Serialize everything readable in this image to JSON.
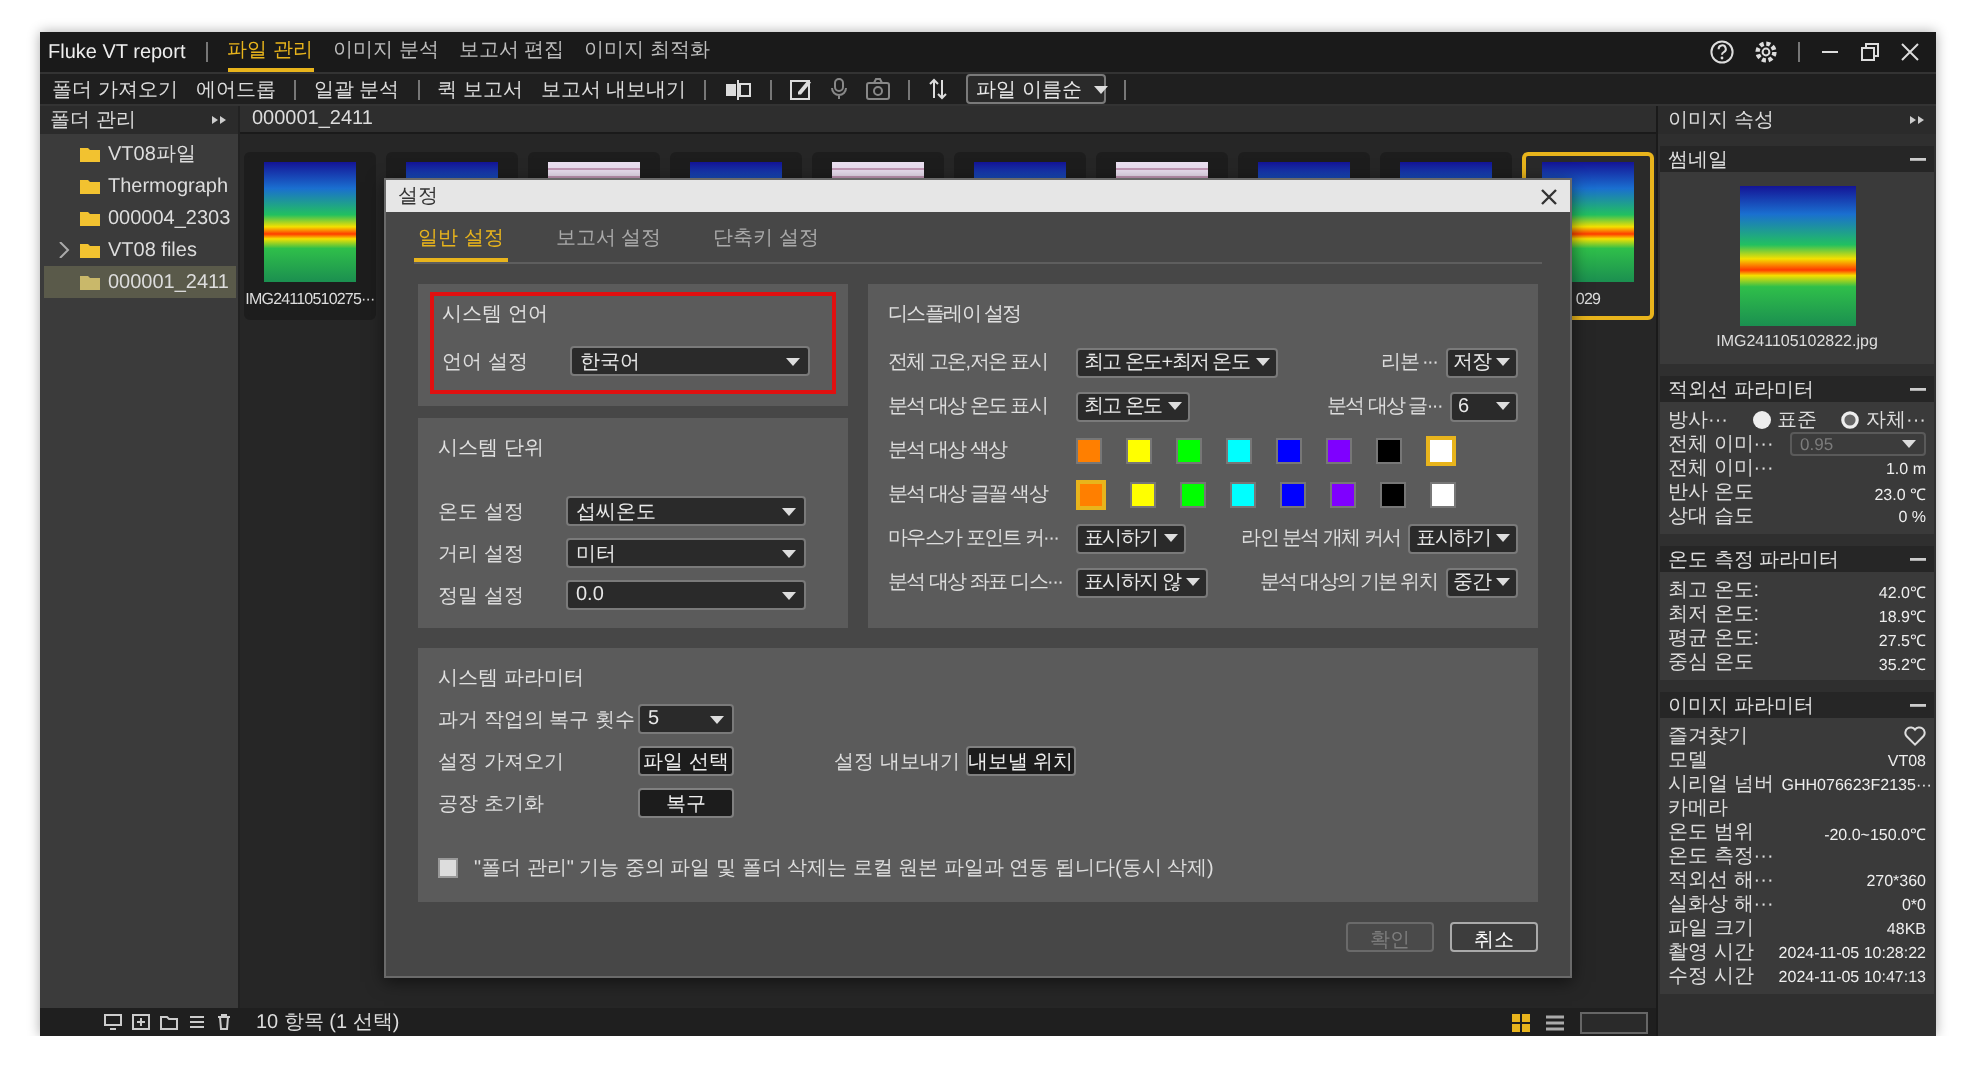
{
  "app": {
    "title": "Fluke VT report"
  },
  "menu_tabs": [
    {
      "label": "파일 관리",
      "selected": true
    },
    {
      "label": "이미지 분석",
      "selected": false
    },
    {
      "label": "보고서 편집",
      "selected": false
    },
    {
      "label": "이미지 최적화",
      "selected": false
    }
  ],
  "toolbar": {
    "groups": [
      [
        "폴더 가져오기",
        "에어드롭"
      ],
      [
        "일괄 분석"
      ],
      [
        "퀵 보고서",
        "보고서 내보내기"
      ]
    ],
    "sort": "파일 이름순"
  },
  "sidebar": {
    "title": "폴더 관리",
    "items": [
      {
        "label": "VT08파일",
        "expandable": false,
        "selected": false
      },
      {
        "label": "Thermograph",
        "expandable": false,
        "selected": false
      },
      {
        "label": "000004_2303",
        "expandable": false,
        "selected": false
      },
      {
        "label": "VT08 files",
        "expandable": true,
        "selected": false
      },
      {
        "label": "000001_2411",
        "expandable": false,
        "selected": true
      }
    ]
  },
  "content": {
    "path": "000001_2411",
    "thumbnails": [
      {
        "kind": "thermal",
        "label": "IMG24110510275···",
        "selected": false
      },
      {
        "kind": "thermal",
        "selected": false
      },
      {
        "kind": "document",
        "selected": false
      },
      {
        "kind": "thermal",
        "selected": false
      },
      {
        "kind": "document",
        "selected": false
      },
      {
        "kind": "thermal",
        "selected": false
      },
      {
        "kind": "document",
        "selected": false
      },
      {
        "kind": "thermal",
        "selected": false
      },
      {
        "kind": "thermal",
        "selected": false
      },
      {
        "kind": "thermal",
        "label": "029",
        "selected": true
      }
    ]
  },
  "settings": {
    "title": "설정",
    "tabs": [
      {
        "label": "일반 설정",
        "selected": true
      },
      {
        "label": "보고서 설정",
        "selected": false
      },
      {
        "label": "단축키 설정",
        "selected": false
      }
    ],
    "language": {
      "title": "시스템 언어",
      "highlighted": true,
      "rows": [
        {
          "label": "언어 설정",
          "value": "한국어"
        }
      ]
    },
    "units": {
      "title": "시스템 단위",
      "rows": [
        {
          "label": "온도 설정",
          "value": "섭씨온도"
        },
        {
          "label": "거리 설정",
          "value": "미터"
        },
        {
          "label": "정밀 설정",
          "value": "0.0"
        }
      ]
    },
    "display": {
      "title": "디스플레이 설정",
      "rows": [
        {
          "kind": "selects",
          "fields": [
            {
              "label": "전체 고온,저온 표시",
              "value": "최고 온도+최저 온도"
            },
            {
              "label": "리본 ···",
              "value": "저장"
            }
          ]
        },
        {
          "kind": "selects",
          "fields": [
            {
              "label": "분석 대상 온도 표시",
              "value": "최고 온도"
            },
            {
              "label": "분석 대상 글···",
              "value": "6"
            }
          ]
        },
        {
          "kind": "swatches",
          "label": "분석 대상 색상",
          "swatches": [
            {
              "color": "#ff7f00",
              "selected": false
            },
            {
              "color": "#ffff00",
              "selected": false
            },
            {
              "color": "#00ff00",
              "selected": false
            },
            {
              "color": "#00ffff",
              "selected": false
            },
            {
              "color": "#0000ff",
              "selected": false
            },
            {
              "color": "#7f00ff",
              "selected": false
            },
            {
              "color": "#000000",
              "selected": false
            },
            {
              "color": "#ffffff",
              "selected": true
            }
          ]
        },
        {
          "kind": "swatches",
          "label": "분석 대상 글꼴 색상",
          "swatches": [
            {
              "color": "#ff7f00",
              "selected": true
            },
            {
              "color": "#ffff00",
              "selected": false
            },
            {
              "color": "#00ff00",
              "selected": false
            },
            {
              "color": "#00ffff",
              "selected": false
            },
            {
              "color": "#0000ff",
              "selected": false
            },
            {
              "color": "#7f00ff",
              "selected": false
            },
            {
              "color": "#000000",
              "selected": false
            },
            {
              "color": "#ffffff",
              "selected": false
            }
          ]
        },
        {
          "kind": "selects",
          "fields": [
            {
              "label": "마우스가 포인트 커···",
              "value": "표시하기"
            },
            {
              "label": "라인 분석 개체 커서",
              "value": "표시하기"
            }
          ]
        },
        {
          "kind": "selects",
          "fields": [
            {
              "label": "분석 대상 좌표 디스···",
              "value": "표시하지 않"
            },
            {
              "label": "분석 대상의 기본 위치",
              "value": "중간"
            }
          ]
        }
      ]
    },
    "parameters": {
      "title": "시스템 파라미터",
      "recovery": {
        "label": "과거 작업의 복구 횟수",
        "value": "5"
      },
      "import": {
        "label": "설정 가져오기",
        "button": "파일 선택"
      },
      "export": {
        "label": "설정 내보내기",
        "button": "내보낼 위치"
      },
      "reset": {
        "label": "공장 초기화",
        "button": "복구"
      },
      "sync_delete": {
        "label": "\"폴더 관리\" 기능 중의 파일 및 폴더 삭제는 로컬 원본 파일과 연동 됩니다(동시 삭제)",
        "checked": false
      }
    },
    "buttons": [
      {
        "label": "확인",
        "disabled": true
      },
      {
        "label": "취소",
        "disabled": false
      }
    ]
  },
  "image_properties": {
    "title": "이미지 속성",
    "thumbnail": {
      "title": "썸네일",
      "filename": "IMG241105102822.jpg"
    },
    "ir_params": {
      "title": "적외선 파라미터",
      "rows": [
        {
          "kind": "radio",
          "label": "방사···",
          "options": [
            {
              "label": "표준",
              "selected": true
            },
            {
              "label": "자체···",
              "selected": false
            }
          ]
        },
        {
          "kind": "select",
          "label": "전체 이미···",
          "value": "0.95",
          "disabled": true
        },
        {
          "kind": "value",
          "label": "전체 이미···",
          "value": "1.0 m"
        },
        {
          "kind": "value",
          "label": "반사 온도",
          "value": "23.0 ℃"
        },
        {
          "kind": "value",
          "label": "상대 습도",
          "value": "0 %"
        }
      ]
    },
    "temperatures": {
      "title": "온도 측정 파라미터",
      "rows": [
        {
          "kind": "value",
          "label": "최고 온도:",
          "value": "42.0℃"
        },
        {
          "kind": "value",
          "label": "최저 온도:",
          "value": "18.9℃"
        },
        {
          "kind": "value",
          "label": "평균 온도:",
          "value": "27.5℃"
        },
        {
          "kind": "value",
          "label": "중심 온도",
          "value": "35.2℃"
        }
      ]
    },
    "image_params": {
      "title": "이미지 파라미터",
      "rows": [
        {
          "kind": "favorite",
          "label": "즐겨찾기",
          "on": false
        },
        {
          "kind": "value",
          "label": "모델",
          "value": "VT08"
        },
        {
          "kind": "value",
          "label": "시리얼 넘버",
          "value": "GHH076623F2135···"
        },
        {
          "kind": "value",
          "label": "카메라"
        },
        {
          "kind": "value",
          "label": "온도 범위",
          "value": "-20.0~150.0℃"
        },
        {
          "kind": "value",
          "label": "온도 측정···"
        },
        {
          "kind": "value",
          "label": "적외선 해···",
          "value": "270*360"
        },
        {
          "kind": "value",
          "label": "실화상 해···",
          "value": "0*0"
        },
        {
          "kind": "value",
          "label": "파일 크기",
          "value": "48KB"
        },
        {
          "kind": "value",
          "label": "촬영 시간",
          "value": "2024-11-05 10:28:22"
        },
        {
          "kind": "value",
          "label": "수정 시간",
          "value": "2024-11-05 10:47:13"
        }
      ]
    }
  },
  "status": {
    "count": "10 항목 (1 선택)"
  }
}
